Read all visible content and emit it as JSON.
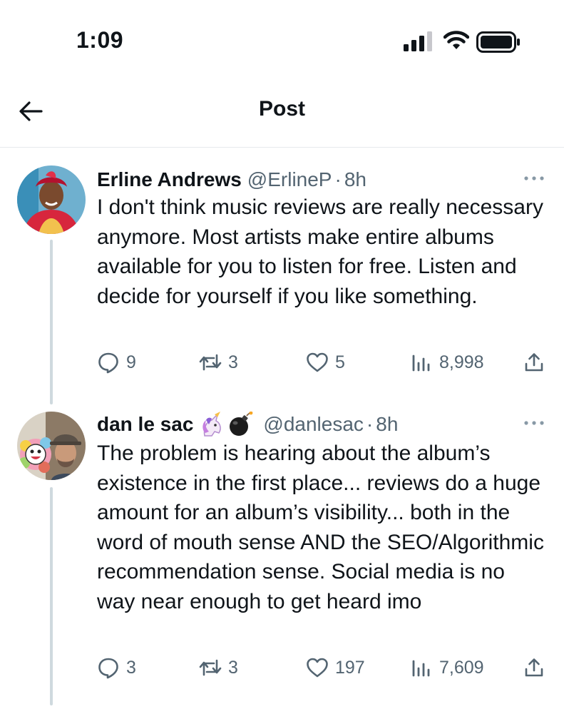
{
  "status_bar": {
    "time": "1:09"
  },
  "nav": {
    "title": "Post"
  },
  "posts": [
    {
      "name": "Erline Andrews",
      "handle": "@ErlineP",
      "separator": "·",
      "time_ago": "8h",
      "text": "I don't think music reviews are really necessary anymore. Most artists make entire albums available for you to listen for free. Listen and decide for yourself if you like something.",
      "replies": "9",
      "reposts": "3",
      "likes": "5",
      "views": "8,998"
    },
    {
      "name": "dan le sac",
      "emoji_icons": [
        "unicorn-emoji",
        "bomb-emoji"
      ],
      "handle": "@danlesac",
      "separator": "·",
      "time_ago": "8h",
      "text": "The problem is hearing about the album’s existence in the first place... reviews do a huge amount for an album’s visibility... both in the word of mouth sense AND the SEO/Algorithmic recommendation sense. Social media is no way near enough to get heard imo",
      "replies": "3",
      "reposts": "3",
      "likes": "197",
      "views": "7,609"
    }
  ],
  "colors": {
    "text": "#0f1419",
    "muted": "#536471",
    "thread_line": "#cfd9de",
    "divider": "#e6e9ec"
  }
}
